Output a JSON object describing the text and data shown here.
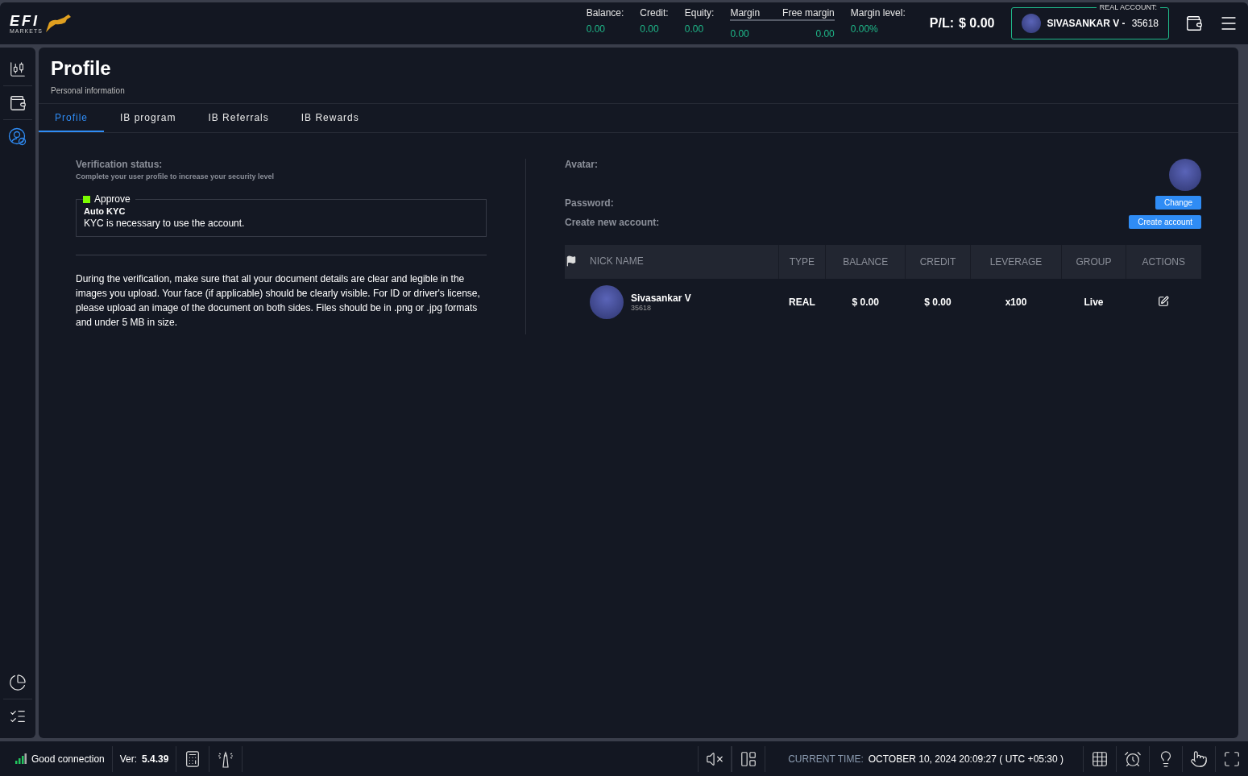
{
  "logo": {
    "word": "EFI",
    "sub": "MARKETS"
  },
  "stats": [
    {
      "kind": "single",
      "label": "Balance:",
      "value": "0.00"
    },
    {
      "kind": "single",
      "label": "Credit:",
      "value": "0.00"
    },
    {
      "kind": "single",
      "label": "Equity:",
      "value": "0.00"
    },
    {
      "kind": "pair",
      "items": [
        {
          "label": "Margin",
          "value": "0.00"
        },
        {
          "label": "Free margin",
          "value": "0.00"
        }
      ]
    },
    {
      "kind": "single",
      "label": "Margin level:",
      "value": "0.00%"
    }
  ],
  "pl": {
    "label": "P/L:",
    "value": "$ 0.00"
  },
  "account": {
    "tag": "REAL ACCOUNT:",
    "name": "SIVASANKAR V -",
    "number": "35618"
  },
  "sidebar": {
    "top": [
      {
        "kind": "chart",
        "selected": false
      },
      {
        "kind": "wallet",
        "selected": false
      },
      {
        "kind": "profile",
        "selected": true
      }
    ],
    "bottom": [
      {
        "kind": "pie",
        "selected": false
      },
      {
        "kind": "checklist",
        "selected": false
      }
    ]
  },
  "page": {
    "title": "Profile",
    "subtitle": "Personal information"
  },
  "tabs": [
    {
      "label": "Profile",
      "selected": true
    },
    {
      "label": "IB program",
      "selected": false
    },
    {
      "label": "IB Referrals",
      "selected": false
    },
    {
      "label": "IB Rewards",
      "selected": false
    }
  ],
  "verification": {
    "title": "Verification status:",
    "hint": "Complete your user profile to increase your security level",
    "status": {
      "label": "Approve",
      "color": "#7cfc00"
    },
    "kyc_title": "Auto KYC",
    "kyc_text": "KYC is necessary to use the account.",
    "note": "During the verification, make sure that all your document details are clear and legible in the images you upload. Your face (if applicable) should be clearly visible. For ID or driver's license, please upload an image of the document on both sides. Files should be in .png or .jpg formats and under 5 MB in size."
  },
  "profile": {
    "avatar_label": "Avatar:",
    "password_label": "Password:",
    "password_button": "Change",
    "create_label": "Create new account:",
    "create_button": "Create account"
  },
  "table": {
    "columns": [
      "NICK NAME",
      "TYPE",
      "BALANCE",
      "CREDIT",
      "LEVERAGE",
      "GROUP",
      "ACTIONS"
    ],
    "rows": [
      {
        "name": "Sivasankar V",
        "number": "35618",
        "type": "REAL",
        "balance": "$ 0.00",
        "credit": "$ 0.00",
        "leverage": "x100",
        "group": "Live"
      }
    ]
  },
  "status_bar": {
    "connection": "Good connection",
    "version_label": "Ver:",
    "version": "5.4.39",
    "time_label": "CURRENT TIME:",
    "time": "OCTOBER 10, 2024 20:09:27 ( UTC +05:30 )"
  }
}
